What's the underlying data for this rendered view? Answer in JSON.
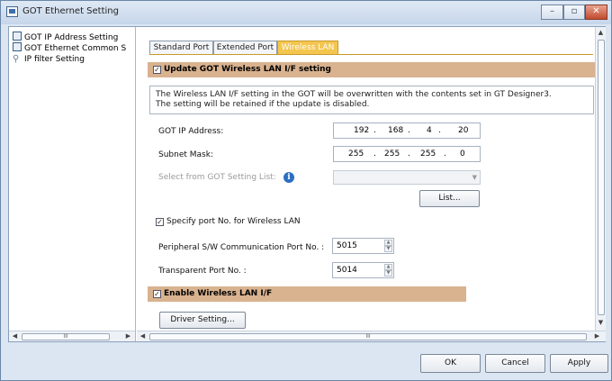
{
  "window": {
    "title": "GOT Ethernet Setting",
    "minimize_label": "–",
    "maximize_label": "▫",
    "close_label": "✕"
  },
  "tree": {
    "items": [
      {
        "label": "GOT IP Address Setting"
      },
      {
        "label": "GOT Ethernet Common S"
      },
      {
        "label": "IP filter Setting"
      }
    ],
    "scroll_thumb": "III"
  },
  "tabs": [
    {
      "label": "Standard Port"
    },
    {
      "label": "Extended Port"
    },
    {
      "label": "Wireless LAN"
    }
  ],
  "wireless": {
    "update_label": "Update GOT Wireless LAN I/F setting",
    "update_checked": "✓",
    "note_line1": "The Wireless LAN I/F setting in the GOT will be overwritten with the contents set in GT Designer3.",
    "note_line2": "The setting will be retained if the update is disabled.",
    "ip_label": "GOT IP Address:",
    "ip": [
      "192",
      "168",
      "4",
      "20"
    ],
    "mask_label": "Subnet Mask:",
    "mask": [
      "255",
      "255",
      "255",
      "0"
    ],
    "dot": ".",
    "select_list_label": "Select from GOT Setting List:",
    "info_glyph": "i",
    "list_button": "List...",
    "specify_port_label": "Specify port No. for Wireless LAN",
    "specify_port_checked": "✓",
    "peripheral_label": "Peripheral S/W Communication Port No. :",
    "peripheral_value": "5015",
    "transparent_label": "Transparent Port No. :",
    "transparent_value": "5014",
    "enable_label": "Enable Wireless LAN I/F",
    "enable_checked": "✓",
    "driver_button": "Driver Setting...",
    "scroll_thumb": "III"
  },
  "footer": {
    "ok": "OK",
    "cancel": "Cancel",
    "apply": "Apply"
  },
  "colors": {
    "section_band": "#d9b28f",
    "active_tab": "#f4c64f",
    "window_bg": "#dbe6f2"
  }
}
